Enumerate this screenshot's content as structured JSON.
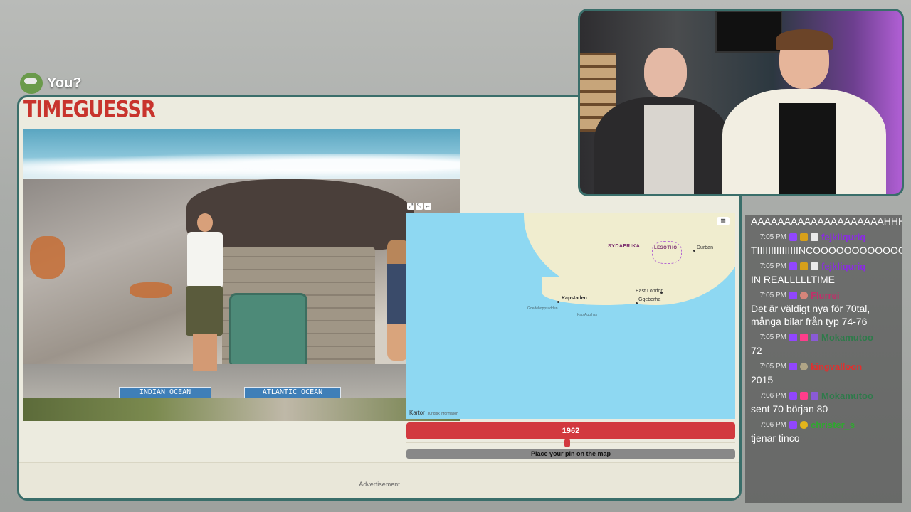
{
  "overlay": {
    "you_label": "You?"
  },
  "game": {
    "logo": "TIMEGUESSR",
    "photo": {
      "sign_left": "INDIAN OCEAN",
      "sign_right": "ATLANTIC OCEAN"
    },
    "map": {
      "country_label": "SYDAFRIKA",
      "lesotho_label": "LESOTHO",
      "cities": [
        "Kapstaden",
        "East London",
        "Gqeberha",
        "Durban"
      ],
      "small_labels": [
        "Goedehoppsudden",
        "Kap Agulhas"
      ],
      "attribution": "Kartor",
      "legal": "Juridisk information"
    },
    "year": "1962",
    "pin_prompt": "Place your pin on the map",
    "advertisement": "Advertisement"
  },
  "chat": {
    "messages": [
      {
        "time": "",
        "name": "",
        "text": "AAAAAAAAAAAAAAAAAAAAHHHHHHH",
        "name_color": "#ffffff"
      },
      {
        "time": "7:05 PM",
        "name": "fejkliquriq",
        "text": "TIIIIIIIIIIIIIIINCOOOOOOOOOOOO",
        "name_color": "#8a2be2"
      },
      {
        "time": "7:05 PM",
        "name": "fejkliquriq",
        "text": "IN REALLLLLTIME",
        "name_color": "#8a2be2"
      },
      {
        "time": "7:05 PM",
        "name": "Flurrei",
        "text": "Det är väldigt nya för 70tal, många bilar från typ 74-76",
        "name_color": "#c0306a"
      },
      {
        "time": "7:05 PM",
        "name": "Mokamutoo",
        "text": "72",
        "name_color": "#2e7a4a"
      },
      {
        "time": "7:05 PM",
        "name": "kingvalloon",
        "text": "2015",
        "name_color": "#e0302e"
      },
      {
        "time": "7:06 PM",
        "name": "Mokamutoo",
        "text": "sent 70 början 80",
        "name_color": "#2e7a4a"
      },
      {
        "time": "7:06 PM",
        "name": "christer_s",
        "text": "tjenar tinco",
        "name_color": "#2fa82f"
      }
    ]
  }
}
